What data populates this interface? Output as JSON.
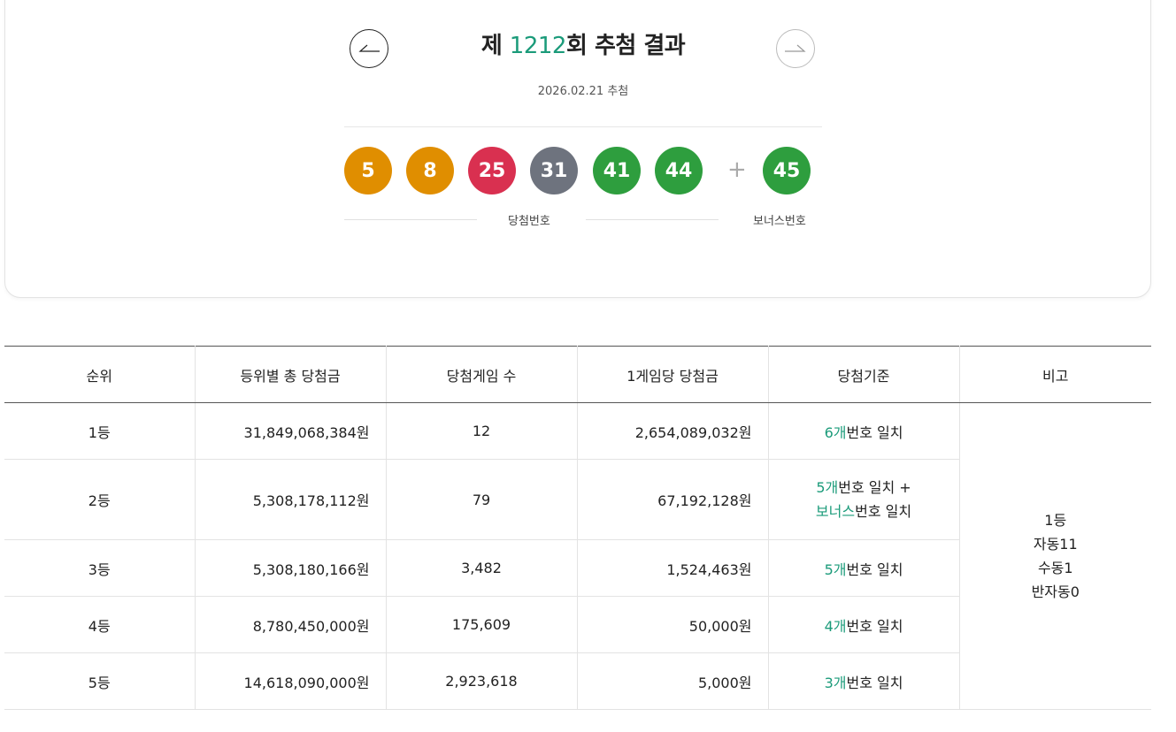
{
  "header": {
    "title_prefix": "제 ",
    "round": "1212",
    "title_suffix": "회 추첨 결과",
    "draw_date": "2026.02.21 추첨"
  },
  "balls": {
    "numbers": [
      {
        "value": "5",
        "color": "#e08e00"
      },
      {
        "value": "8",
        "color": "#e08e00"
      },
      {
        "value": "25",
        "color": "#d93050"
      },
      {
        "value": "31",
        "color": "#6e737e"
      },
      {
        "value": "41",
        "color": "#2e9e3e"
      },
      {
        "value": "44",
        "color": "#2e9e3e"
      }
    ],
    "plus": "+",
    "bonus": {
      "value": "45",
      "color": "#2e9e3e"
    },
    "winning_label": "당첨번호",
    "bonus_label": "보너스번호"
  },
  "table": {
    "headers": [
      "순위",
      "등위별 총 당첨금",
      "당첨게임 수",
      "1게임당 당첨금",
      "당첨기준",
      "비고"
    ],
    "rows": [
      {
        "rank": "1등",
        "total": "31,849,068,384원",
        "games": "12",
        "per_game": "2,654,089,032원",
        "crit_count": "6개",
        "crit_text": "번호 일치"
      },
      {
        "rank": "2등",
        "total": "5,308,178,112원",
        "games": "79",
        "per_game": "67,192,128원",
        "crit_count": "5개",
        "crit_text": "번호 일치 +",
        "crit_bonus": "보너스",
        "crit_bonus_text": "번호 일치"
      },
      {
        "rank": "3등",
        "total": "5,308,180,166원",
        "games": "3,482",
        "per_game": "1,524,463원",
        "crit_count": "5개",
        "crit_text": "번호 일치"
      },
      {
        "rank": "4등",
        "total": "8,780,450,000원",
        "games": "175,609",
        "per_game": "50,000원",
        "crit_count": "4개",
        "crit_text": "번호 일치"
      },
      {
        "rank": "5등",
        "total": "14,618,090,000원",
        "games": "2,923,618",
        "per_game": "5,000원",
        "crit_count": "3개",
        "crit_text": "번호 일치"
      }
    ],
    "remark": [
      "1등",
      "자동11",
      "수동1",
      "반자동0"
    ]
  },
  "colors": {
    "accent_green": "#1b9b7a"
  },
  "icons": {
    "prev": "arrow-left-icon",
    "next": "arrow-right-icon"
  }
}
